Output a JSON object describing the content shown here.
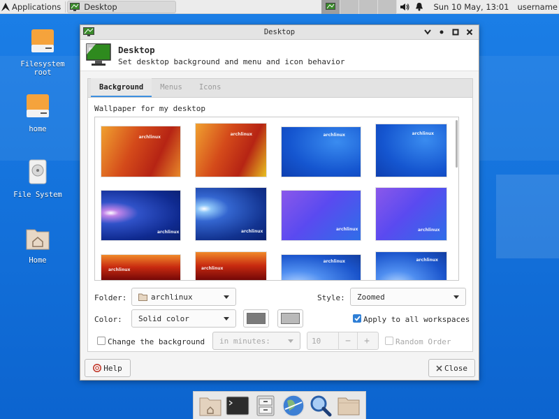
{
  "panel": {
    "applications_label": "Applications",
    "task_label": "Desktop",
    "clock": "Sun 10 May, 13:01",
    "username": "username",
    "icons": [
      "arch-logo-icon",
      "desktop-app-icon",
      "volume-icon",
      "bell-icon"
    ]
  },
  "desktop_icons": [
    {
      "label": "Filesystem root",
      "icon": "drive-orange-icon"
    },
    {
      "label": "home",
      "icon": "drive-orange-icon"
    },
    {
      "label": "File System",
      "icon": "harddisk-icon"
    },
    {
      "label": "Home",
      "icon": "home-folder-icon"
    }
  ],
  "window": {
    "title": "Desktop",
    "header_title": "Desktop",
    "header_subtitle": "Set desktop background and menu and icon behavior",
    "tabs": [
      {
        "label": "Background",
        "active": true
      },
      {
        "label": "Menus",
        "active": false
      },
      {
        "label": "Icons",
        "active": false
      }
    ],
    "wallpaper_label": "Wallpaper for my desktop",
    "wallpaper_brand": "archlinux",
    "folder_label": "Folder:",
    "folder_value": "archlinux",
    "style_label": "Style:",
    "style_value": "Zoomed",
    "color_label": "Color:",
    "color_value": "Solid color",
    "color1": "#7a7a7a",
    "color2": "#b9b9b9",
    "apply_all_label": "Apply to all workspaces",
    "apply_all_checked": true,
    "change_bg_label": "Change the background",
    "change_bg_checked": false,
    "interval_value": "in minutes:",
    "spin_value": "10",
    "spin_minus": "−",
    "spin_plus": "+",
    "random_label": "Random Order",
    "random_checked": false,
    "help_label": "Help",
    "close_label": "Close"
  },
  "dock": {
    "items": [
      "home-folder-icon",
      "terminal-icon",
      "file-manager-icon",
      "web-browser-icon",
      "search-icon",
      "folder-icon"
    ]
  },
  "colors": {
    "desktop_bg": "#1b7ee6",
    "accent": "#2f7fd6",
    "panel_bg": "#ececec"
  }
}
